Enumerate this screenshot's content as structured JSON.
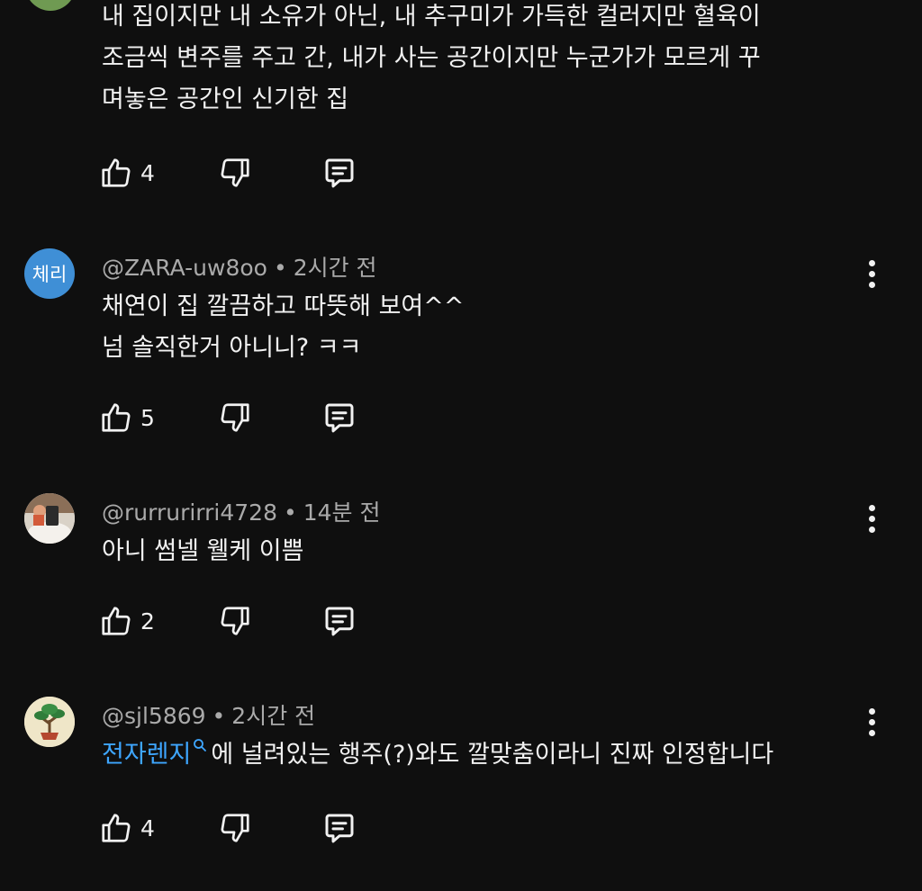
{
  "comments": [
    {
      "text": "내 집이지만 내 소유가 아닌, 내 추구미가 가득한 컬러지만 혈육이\n조금씩 변주를 주고 간, 내가 사는 공간이지만 누군가가 모르게 꾸\n며놓은 공간인 신기한 집",
      "likes": "4"
    },
    {
      "avatar_text": "체리",
      "author": "@ZARA-uw8oo",
      "time": "2시간 전",
      "text": "채연이 집 깔끔하고 따뜻해 보여^^\n넘 솔직한거 아니니? ㅋㅋ",
      "likes": "5"
    },
    {
      "author": "@rurrurirri4728",
      "time": "14분 전",
      "text": "아니 썸넬 웰케 이쁨",
      "likes": "2"
    },
    {
      "author": "@sjl5869",
      "time": "2시간 전",
      "link_text": "전자렌지",
      "text_after_link": "에 널려있는 행주(?)와도 깔맞춤이라니 진짜 인정합니다",
      "likes": "4"
    }
  ],
  "meta_separator": "•",
  "icons": {
    "like": "thumb-up-icon",
    "dislike": "thumb-down-icon",
    "reply": "reply-comment-icon",
    "more": "more-vertical-icon",
    "search": "search-icon"
  },
  "colors": {
    "background": "#0f0f0f",
    "text": "#f1f1f1",
    "secondary_text": "#aaaaaa",
    "link": "#3ea6ff",
    "avatar_zara": "#3f8fd6"
  }
}
